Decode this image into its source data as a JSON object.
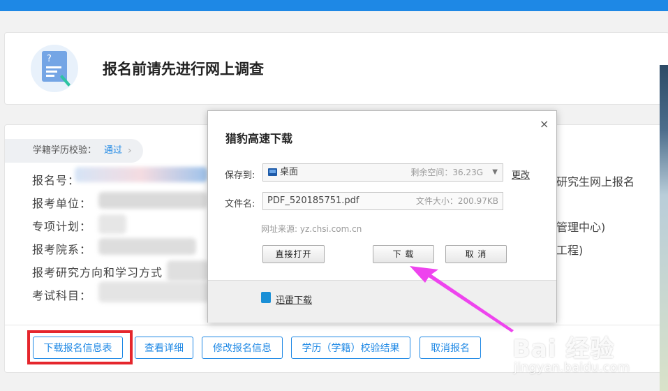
{
  "colors": {
    "accent": "#1e88e5",
    "highlight": "#e5262c",
    "arrow": "#ee44ee"
  },
  "header": {
    "title": "报名前请先进行网上调查",
    "icon": "survey-document-icon"
  },
  "status": {
    "label": "学籍学历校验：",
    "value": "通过"
  },
  "info": {
    "rows": [
      {
        "label": "报名号："
      },
      {
        "label": "报考单位："
      },
      {
        "label": "专项计划："
      },
      {
        "label": "报考院系："
      },
      {
        "label": "报考研究方向和学习方式"
      },
      {
        "label": "考试科目："
      }
    ],
    "right_texts": [
      "研究生网上报名",
      "管理中心)",
      "工程)"
    ]
  },
  "actions": {
    "download": "下载报名信息表",
    "details": "查看详细",
    "modify": "修改报名信息",
    "verify": "学历（学籍）校验结果",
    "cancel": "取消报名"
  },
  "dialog": {
    "title": "猎豹高速下载",
    "close": "×",
    "save_to_label": "保存到:",
    "save_to_value": "桌面",
    "free_space": "剩余空间：36.23G",
    "change": "更改",
    "filename_label": "文件名:",
    "filename": "PDF_520185751.pdf",
    "filesize": "文件大小：200.97KB",
    "source": "网址来源: yz.chsi.com.cn",
    "open_direct": "直接打开",
    "download": "下 载",
    "cancel": "取 消",
    "thunder": "迅雷下载"
  },
  "watermark": {
    "brand": "Bai  经验",
    "url": "jingyan.baidu.com"
  }
}
